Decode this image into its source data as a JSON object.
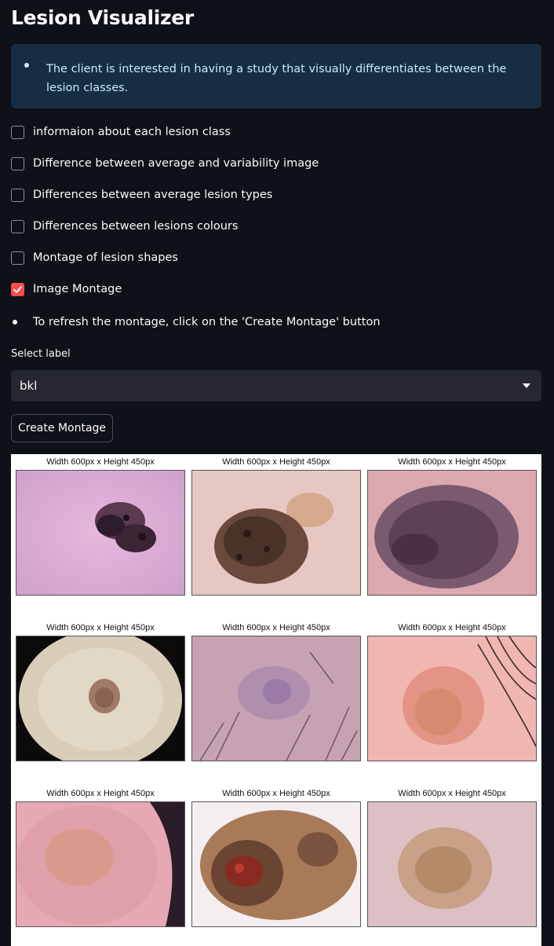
{
  "page": {
    "title": "Lesion Visualizer"
  },
  "info": {
    "text": "The client is interested in having a study that visually differentiates between the lesion classes."
  },
  "checkboxes": [
    {
      "label": "informaion about each lesion class",
      "checked": false
    },
    {
      "label": "Difference between average and variability image",
      "checked": false
    },
    {
      "label": "Differences between average lesion types",
      "checked": false
    },
    {
      "label": "Differences between lesions colours",
      "checked": false
    },
    {
      "label": "Montage of lesion shapes",
      "checked": false
    },
    {
      "label": "Image Montage",
      "checked": true
    }
  ],
  "bullet_note": "To refresh the montage, click on the 'Create Montage' button",
  "select": {
    "label": "Select label",
    "value": "bkl"
  },
  "button": {
    "label": "Create Montage"
  },
  "montage": {
    "captions": [
      "Width 600px x Height 450px",
      "Width 600px x Height 450px",
      "Width 600px x Height 450px",
      "Width 600px x Height 450px",
      "Width 600px x Height 450px",
      "Width 600px x Height 450px",
      "Width 600px x Height 450px",
      "Width 600px x Height 450px",
      "Width 600px x Height 450px"
    ]
  },
  "colors": {
    "background": "#0e1117",
    "info_bg": "#172d43",
    "info_text": "#c7ebff",
    "accent": "#ff4b4b",
    "select_bg": "#262730"
  }
}
